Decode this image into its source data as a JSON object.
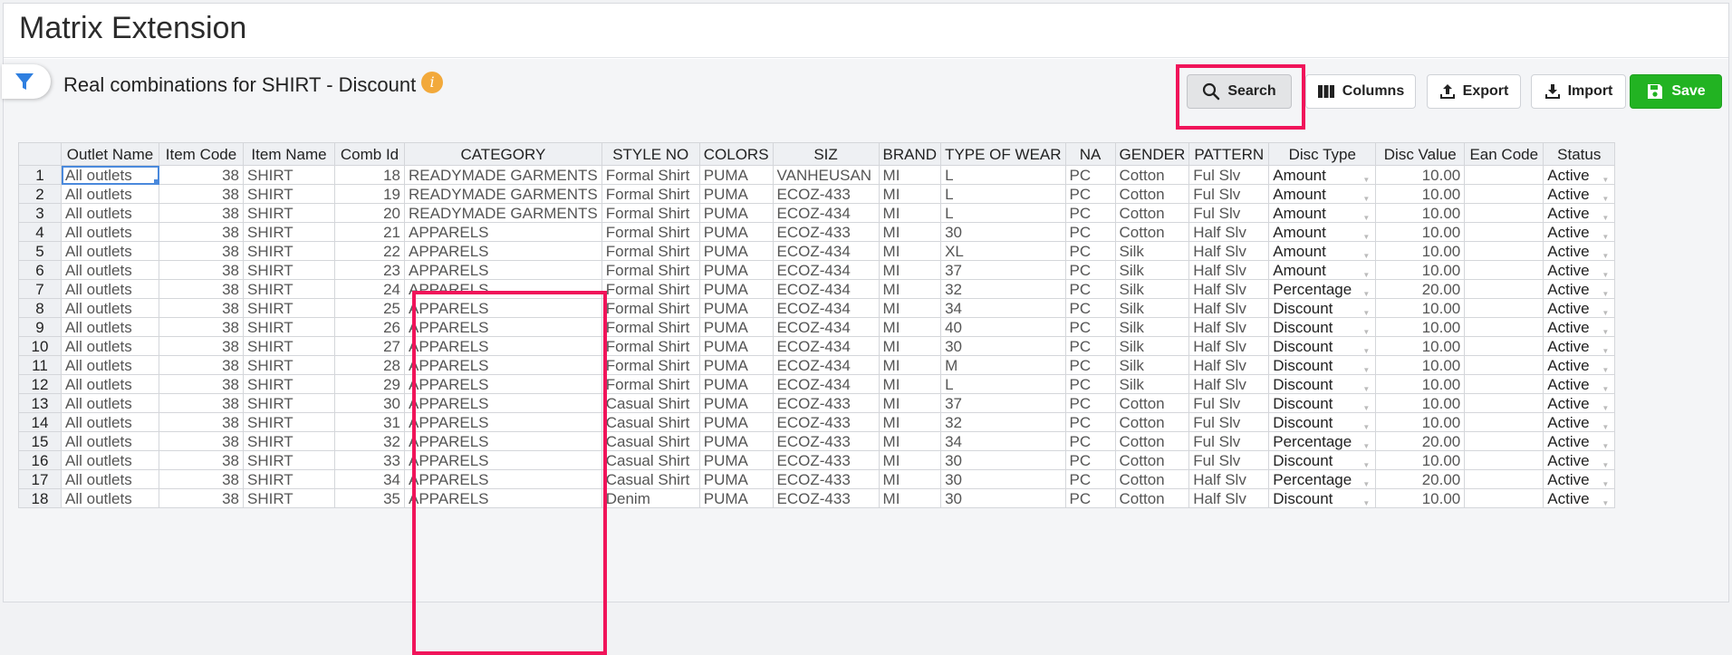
{
  "page": {
    "title": "Matrix Extension"
  },
  "header": {
    "subtitle": "Real combinations for SHIRT - Discount",
    "info_glyph": "i"
  },
  "toolbar": {
    "search_label": "Search",
    "columns_label": "Columns",
    "export_label": "Export",
    "import_label": "Import",
    "save_label": "Save"
  },
  "colors": {
    "save": "#22b322",
    "highlight": "#f0145a",
    "filter": "#2f7fe0",
    "info": "#f2a93b"
  },
  "grid": {
    "columns": [
      "",
      "Outlet Name",
      "Item Code",
      "Item Name",
      "Comb Id",
      "CATEGORY",
      "STYLE NO",
      "COLORS",
      "SIZ",
      "BRAND",
      "TYPE OF WEAR",
      "NA",
      "GENDER",
      "PATTERN",
      "Disc Type",
      "Disc Value",
      "Ean Code",
      "Status"
    ],
    "rows": [
      [
        "1",
        "All outlets",
        "38",
        "SHIRT",
        "18",
        "READYMADE GARMENTS",
        "Formal Shirt",
        "PUMA",
        "VANHEUSAN",
        "MI",
        "L",
        "PC",
        "Cotton",
        "Ful Slv",
        "Amount",
        "10.00",
        "",
        "Active"
      ],
      [
        "2",
        "All outlets",
        "38",
        "SHIRT",
        "19",
        "READYMADE GARMENTS",
        "Formal Shirt",
        "PUMA",
        "ECOZ-433",
        "MI",
        "L",
        "PC",
        "Cotton",
        "Ful Slv",
        "Amount",
        "10.00",
        "",
        "Active"
      ],
      [
        "3",
        "All outlets",
        "38",
        "SHIRT",
        "20",
        "READYMADE GARMENTS",
        "Formal Shirt",
        "PUMA",
        "ECOZ-434",
        "MI",
        "L",
        "PC",
        "Cotton",
        "Ful Slv",
        "Amount",
        "10.00",
        "",
        "Active"
      ],
      [
        "4",
        "All outlets",
        "38",
        "SHIRT",
        "21",
        "APPARELS",
        "Formal Shirt",
        "PUMA",
        "ECOZ-433",
        "MI",
        "30",
        "PC",
        "Cotton",
        "Half Slv",
        "Amount",
        "10.00",
        "",
        "Active"
      ],
      [
        "5",
        "All outlets",
        "38",
        "SHIRT",
        "22",
        "APPARELS",
        "Formal Shirt",
        "PUMA",
        "ECOZ-434",
        "MI",
        "XL",
        "PC",
        "Silk",
        "Half Slv",
        "Amount",
        "10.00",
        "",
        "Active"
      ],
      [
        "6",
        "All outlets",
        "38",
        "SHIRT",
        "23",
        "APPARELS",
        "Formal Shirt",
        "PUMA",
        "ECOZ-434",
        "MI",
        "37",
        "PC",
        "Silk",
        "Half Slv",
        "Amount",
        "10.00",
        "",
        "Active"
      ],
      [
        "7",
        "All outlets",
        "38",
        "SHIRT",
        "24",
        "APPARELS",
        "Formal Shirt",
        "PUMA",
        "ECOZ-434",
        "MI",
        "32",
        "PC",
        "Silk",
        "Half Slv",
        "Percentage",
        "20.00",
        "",
        "Active"
      ],
      [
        "8",
        "All outlets",
        "38",
        "SHIRT",
        "25",
        "APPARELS",
        "Formal Shirt",
        "PUMA",
        "ECOZ-434",
        "MI",
        "34",
        "PC",
        "Silk",
        "Half Slv",
        "Discount",
        "10.00",
        "",
        "Active"
      ],
      [
        "9",
        "All outlets",
        "38",
        "SHIRT",
        "26",
        "APPARELS",
        "Formal Shirt",
        "PUMA",
        "ECOZ-434",
        "MI",
        "40",
        "PC",
        "Silk",
        "Half Slv",
        "Discount",
        "10.00",
        "",
        "Active"
      ],
      [
        "10",
        "All outlets",
        "38",
        "SHIRT",
        "27",
        "APPARELS",
        "Formal Shirt",
        "PUMA",
        "ECOZ-434",
        "MI",
        "30",
        "PC",
        "Silk",
        "Half Slv",
        "Discount",
        "10.00",
        "",
        "Active"
      ],
      [
        "11",
        "All outlets",
        "38",
        "SHIRT",
        "28",
        "APPARELS",
        "Formal Shirt",
        "PUMA",
        "ECOZ-434",
        "MI",
        "M",
        "PC",
        "Silk",
        "Half Slv",
        "Discount",
        "10.00",
        "",
        "Active"
      ],
      [
        "12",
        "All outlets",
        "38",
        "SHIRT",
        "29",
        "APPARELS",
        "Formal Shirt",
        "PUMA",
        "ECOZ-434",
        "MI",
        "L",
        "PC",
        "Silk",
        "Half Slv",
        "Discount",
        "10.00",
        "",
        "Active"
      ],
      [
        "13",
        "All outlets",
        "38",
        "SHIRT",
        "30",
        "APPARELS",
        "Casual Shirt",
        "PUMA",
        "ECOZ-433",
        "MI",
        "37",
        "PC",
        "Cotton",
        "Ful Slv",
        "Discount",
        "10.00",
        "",
        "Active"
      ],
      [
        "14",
        "All outlets",
        "38",
        "SHIRT",
        "31",
        "APPARELS",
        "Casual Shirt",
        "PUMA",
        "ECOZ-433",
        "MI",
        "32",
        "PC",
        "Cotton",
        "Ful Slv",
        "Discount",
        "10.00",
        "",
        "Active"
      ],
      [
        "15",
        "All outlets",
        "38",
        "SHIRT",
        "32",
        "APPARELS",
        "Casual Shirt",
        "PUMA",
        "ECOZ-433",
        "MI",
        "34",
        "PC",
        "Cotton",
        "Ful Slv",
        "Percentage",
        "20.00",
        "",
        "Active"
      ],
      [
        "16",
        "All outlets",
        "38",
        "SHIRT",
        "33",
        "APPARELS",
        "Casual Shirt",
        "PUMA",
        "ECOZ-433",
        "MI",
        "30",
        "PC",
        "Cotton",
        "Ful Slv",
        "Discount",
        "10.00",
        "",
        "Active"
      ],
      [
        "17",
        "All outlets",
        "38",
        "SHIRT",
        "34",
        "APPARELS",
        "Casual Shirt",
        "PUMA",
        "ECOZ-433",
        "MI",
        "30",
        "PC",
        "Cotton",
        "Half Slv",
        "Percentage",
        "20.00",
        "",
        "Active"
      ],
      [
        "18",
        "All outlets",
        "38",
        "SHIRT",
        "35",
        "APPARELS",
        "Denim",
        "PUMA",
        "ECOZ-433",
        "MI",
        "30",
        "PC",
        "Cotton",
        "Half Slv",
        "Discount",
        "10.00",
        "",
        "Active"
      ]
    ]
  }
}
